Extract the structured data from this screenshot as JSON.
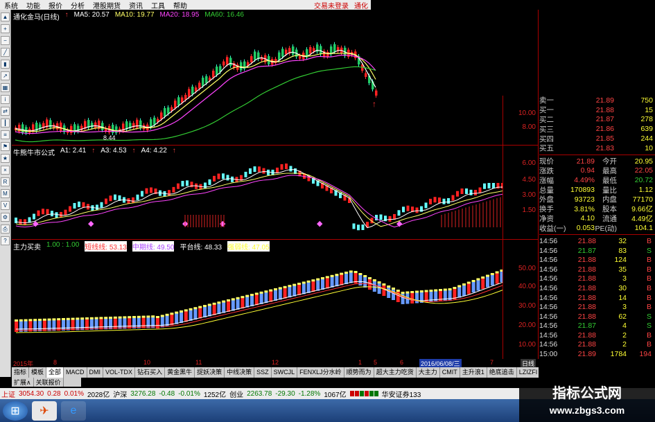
{
  "menu": [
    "系统",
    "功能",
    "报价",
    "分析",
    "港股期货",
    "资讯",
    "工具",
    "帮助"
  ],
  "menu_right": [
    "交易未登录",
    "通化"
  ],
  "panel1": {
    "title": "通化金马(日线)",
    "legend": [
      {
        "text": "MA5: 20.57",
        "color": "#ffffff"
      },
      {
        "text": "MA10: 19.77",
        "color": "#ffff66"
      },
      {
        "text": "MA20: 18.95",
        "color": "#ff44ff"
      },
      {
        "text": "MA60: 16.46",
        "color": "#33cc33"
      }
    ],
    "ticks": [
      "10.00",
      "8.00"
    ],
    "low_label": "8.44"
  },
  "panel2": {
    "title": "牛熊牛市公式",
    "legend": [
      {
        "text": "A1: 2.41",
        "color": "#ffffff"
      },
      {
        "text": "A3: 4.53",
        "color": "#ffffff"
      },
      {
        "text": "A4: 4.22",
        "color": "#ffffff"
      }
    ],
    "ticks": [
      "6.00",
      "4.50",
      "3.00",
      "1.50"
    ]
  },
  "panel3": {
    "title": "主力买卖",
    "legend": [
      {
        "text": "1.00 : 1.00",
        "color": "#33cc33"
      },
      {
        "text": "短线线: 53.13",
        "color": "#ff3333",
        "bg": "#ffffff"
      },
      {
        "text": "中期线: 49.50",
        "color": "#aa44ff",
        "bg": "#ffffff"
      },
      {
        "text": "平台线: 48.33",
        "color": "#ffffff"
      },
      {
        "text": "强弱线: 47.05",
        "color": "#ffff33",
        "bg": "#ffffff"
      }
    ],
    "ticks": [
      "50.00",
      "40.00",
      "30.00",
      "20.00",
      "10.00"
    ]
  },
  "time_axis": [
    "2015年",
    "8",
    "10",
    "11",
    "12",
    "1",
    "5",
    "6",
    "7"
  ],
  "date_box": "2016/06/08/三",
  "period": "日线",
  "tabs": [
    "指标",
    "模板",
    "全部",
    "MACD",
    "DMI",
    "VOL-TDX",
    "钻石买入",
    "黄金黑牛",
    "捉妖决策",
    "中线决策",
    "SSZ",
    "SWCJL",
    "FENXLJ分水岭",
    "顺势而为",
    "超大主力吃货",
    "大主力",
    "CMIT",
    "主升浪1",
    "绝底追击",
    "LZIZFI",
    "CMJC",
    "高手专用",
    "持仓线"
  ],
  "tabs2": [
    "扩展∧",
    "关联报价"
  ],
  "quote": {
    "asks": [
      {
        "label": "卖一",
        "price": "21.89",
        "vol": "750"
      },
      {
        "label": "买一",
        "price": "21.88",
        "vol": "15"
      },
      {
        "label": "买二",
        "price": "21.87",
        "vol": "278"
      },
      {
        "label": "买三",
        "price": "21.86",
        "vol": "639"
      },
      {
        "label": "买四",
        "price": "21.85",
        "vol": "244"
      },
      {
        "label": "买五",
        "price": "21.83",
        "vol": "10"
      }
    ],
    "stats": [
      {
        "l1": "现价",
        "v1": "21.89",
        "l2": "今开",
        "v2": "20.95"
      },
      {
        "l1": "涨跌",
        "v1": "0.94",
        "l2": "最高",
        "v2": "22.05"
      },
      {
        "l1": "涨幅",
        "v1": "4.49%",
        "l2": "最低",
        "v2": "20.72"
      },
      {
        "l1": "总量",
        "v1": "170893",
        "l2": "量比",
        "v2": "1.12"
      },
      {
        "l1": "外盘",
        "v1": "93723",
        "l2": "内盘",
        "v2": "77170"
      },
      {
        "l1": "换手",
        "v1": "3.81%",
        "l2": "股本",
        "v2": "9.66亿"
      },
      {
        "l1": "净资",
        "v1": "4.10",
        "l2": "流通",
        "v2": "4.49亿"
      },
      {
        "l1": "收益(一)",
        "v1": "0.053",
        "l2": "PE(动)",
        "v2": "104.1"
      }
    ],
    "ticks": [
      {
        "t": "14:56",
        "p": "21.88",
        "v": "32",
        "s": "B"
      },
      {
        "t": "14:56",
        "p": "21.87",
        "v": "83",
        "s": "S"
      },
      {
        "t": "14:56",
        "p": "21.88",
        "v": "124",
        "s": "B"
      },
      {
        "t": "14:56",
        "p": "21.88",
        "v": "35",
        "s": "B"
      },
      {
        "t": "14:56",
        "p": "21.88",
        "v": "3",
        "s": "B"
      },
      {
        "t": "14:56",
        "p": "21.88",
        "v": "30",
        "s": "B"
      },
      {
        "t": "14:56",
        "p": "21.88",
        "v": "14",
        "s": "B"
      },
      {
        "t": "14:56",
        "p": "21.88",
        "v": "3",
        "s": "B"
      },
      {
        "t": "14:56",
        "p": "21.88",
        "v": "62",
        "s": "S"
      },
      {
        "t": "14:56",
        "p": "21.87",
        "v": "4",
        "s": "S"
      },
      {
        "t": "14:56",
        "p": "21.88",
        "v": "2",
        "s": "B"
      },
      {
        "t": "14:56",
        "p": "21.88",
        "v": "2",
        "s": "B"
      },
      {
        "t": "15:00",
        "p": "21.89",
        "v": "1784",
        "s": "194"
      }
    ]
  },
  "status": {
    "sh_label": "上证",
    "sh_val": "3054.30",
    "sh_chg": "0.28",
    "sh_pct": "0.01%",
    "sh_amt": "2028亿",
    "sz_label": "沪深",
    "sz_val": "3276.28",
    "sz_chg": "-0.48",
    "sz_pct": "-0.01%",
    "sz_amt": "1252亿",
    "cy_label": "创业",
    "cy_val": "2263.78",
    "cy_chg": "-29.30",
    "cy_pct": "-1.28%",
    "cy_amt": "1067亿",
    "broker": "华安证券133"
  },
  "watermark": {
    "title": "指标公式网",
    "url": "www.zbgs3.com"
  }
}
